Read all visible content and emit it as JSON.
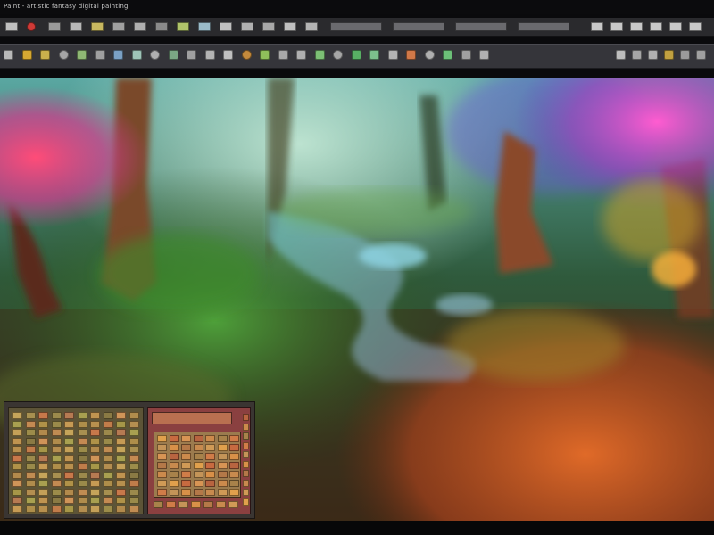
{
  "window": {
    "title": "Paint - artistic fantasy digital painting"
  },
  "menubar": {
    "button_colors": [
      "#c0c0c0",
      "#cf3a36",
      "#9a9a9a",
      "#b8b8b8",
      "#c8b860",
      "#a0a0a0",
      "#b0b0b0",
      "#8a8a8a",
      "#b0c46a",
      "#9abac8",
      "#c0c0c0",
      "#b0b0b0",
      "#a8a8a8",
      "#c0c0c0",
      "#b4b4b4"
    ]
  },
  "toolbar": {
    "tool_colors": [
      "#b9b9b9",
      "#d6a832",
      "#c9b04c",
      "#a6a6a6",
      "#8fb874",
      "#a0a0a0",
      "#7aa0c4",
      "#9ec4b8",
      "#b0b0b0",
      "#7aa884",
      "#a0a0a0",
      "#b4b4b4",
      "#c0c0c0",
      "#c48a3c",
      "#8fbf5a",
      "#a8a8a8",
      "#b0b0b0",
      "#7cbf74",
      "#a6a6a6",
      "#58b064",
      "#7cc08c",
      "#b4b4b4",
      "#d07848",
      "#b0b0b0",
      "#6cc078",
      "#a0a0a0",
      "#b0b0b0"
    ],
    "right_tool_colors": [
      "#bdbdbd",
      "#a6a6a6",
      "#b0b0b0",
      "#c0a040",
      "#9a9a9a",
      "#a0a0a0"
    ]
  },
  "palette": {
    "left_colors": [
      "#c5a45a",
      "#a89050",
      "#c8784a",
      "#9c8a4c",
      "#b67a52",
      "#a8a050",
      "#c09450",
      "#8a7a44",
      "#cf9458",
      "#b08c4c",
      "#a8a050",
      "#c48a52",
      "#b09248",
      "#9a8a4a",
      "#c69a54",
      "#ae8e4a",
      "#b8904e",
      "#c07c4a",
      "#a69648",
      "#b48e50",
      "#c4a058",
      "#9c8c4a",
      "#b28a4c",
      "#c08c52"
    ],
    "right_colors": [
      "#e0a04c",
      "#c86a40",
      "#d89454",
      "#b86440",
      "#cc8a4c",
      "#a8824a",
      "#d07c48",
      "#c49458",
      "#d89048",
      "#b47848",
      "#c88a4e",
      "#d09a56"
    ]
  }
}
